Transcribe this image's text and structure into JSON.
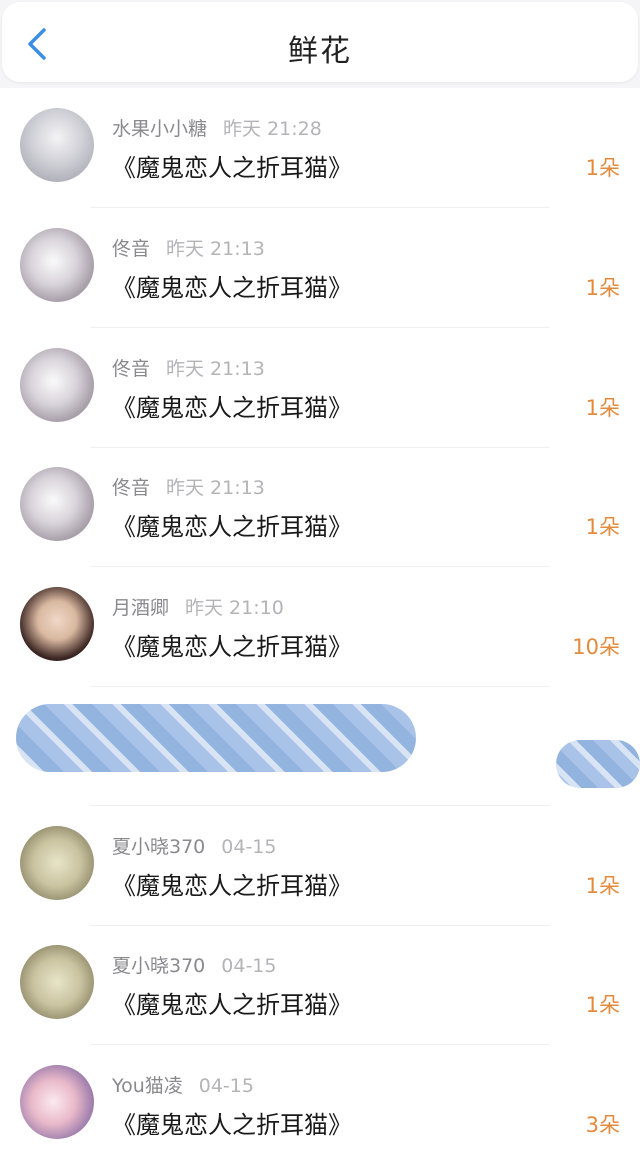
{
  "header": {
    "title": "鲜花",
    "back_icon": "chevron-left-icon",
    "accent_color": "#3a8ee6"
  },
  "rows": [
    {
      "name": "水果小小糖",
      "time": "昨天 21:28",
      "book": "《魔鬼恋人之折耳猫》",
      "count": "1朵"
    },
    {
      "name": "佟音",
      "time": "昨天 21:13",
      "book": "《魔鬼恋人之折耳猫》",
      "count": "1朵"
    },
    {
      "name": "佟音",
      "time": "昨天 21:13",
      "book": "《魔鬼恋人之折耳猫》",
      "count": "1朵"
    },
    {
      "name": "佟音",
      "time": "昨天 21:13",
      "book": "《魔鬼恋人之折耳猫》",
      "count": "1朵"
    },
    {
      "name": "月酒卿",
      "time": "昨天 21:10",
      "book": "《魔鬼恋人之折耳猫》",
      "count": "10朵"
    },
    {
      "redacted": true
    },
    {
      "name": "夏小晓370",
      "time": "04-15",
      "book": "《魔鬼恋人之折耳猫》",
      "count": "1朵"
    },
    {
      "name": "夏小晓370",
      "time": "04-15",
      "book": "《魔鬼恋人之折耳猫》",
      "count": "1朵"
    },
    {
      "name": "You猫凌",
      "time": "04-15",
      "book": "《魔鬼恋人之折耳猫》",
      "count": "3朵"
    }
  ],
  "colors": {
    "count": "#e48a3c",
    "name": "#8a8a8e",
    "time": "#b4b4b8",
    "redaction": "#a9c3e8"
  }
}
